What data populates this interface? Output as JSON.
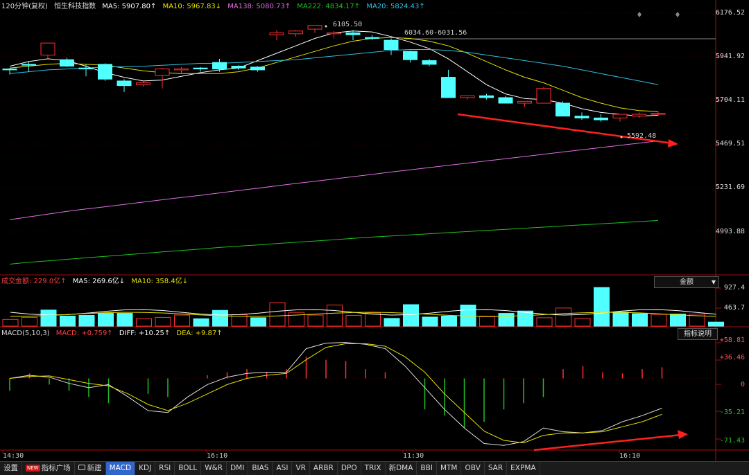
{
  "header": {
    "title": "120分钟(复权)",
    "instrument": "恒生科技指数",
    "ma5": "MA5: 5907.80↑",
    "ma10": "MA10: 5967.83↓",
    "ma138": "MA138: 5080.73↑",
    "ma222": "MA222: 4834.17↑",
    "ma20": "MA20: 5824.43↑"
  },
  "colors": {
    "ma5": "#ffffff",
    "ma10": "#e8e000",
    "ma138": "#e070e0",
    "ma222": "#20c020",
    "ma20": "#30c0e0",
    "up": "#ff3030",
    "down": "#50ffff",
    "annotation_arrow": "#ff2020"
  },
  "price_axis": [
    "6176.52",
    "5941.92",
    "5704.11",
    "5469.51",
    "5231.69",
    "4993.88"
  ],
  "annotations": {
    "high": "6105.50",
    "range": "6034.60-6031.56",
    "low": "5592.48"
  },
  "volume": {
    "label": "成交金额: 229.0亿↑",
    "ma5": "MA5: 269.6亿↓",
    "ma10": "MA10: 358.4亿↓",
    "axis": [
      "927.4",
      "463.7"
    ],
    "dropdown": "金额"
  },
  "macd": {
    "label": "MACD(5,10,3)",
    "macd": "MACD: +0.759↑",
    "diff": "DIFF: +10.25↑",
    "dea": "DEA: +9.87↑",
    "axis": [
      "+58.81",
      "+36.46",
      "0",
      "-35.21",
      "-71.43"
    ],
    "button": "指标说明"
  },
  "time_axis": [
    "14:30",
    "16:10",
    "11:30",
    "16:10"
  ],
  "toolbar": {
    "settings": "设置",
    "new_badge": "NEW",
    "indicator_plaza": "指标广场",
    "new_create": "新建",
    "tabs": [
      "MACD",
      "KDJ",
      "RSI",
      "BOLL",
      "W&R",
      "DMI",
      "BIAS",
      "ASI",
      "VR",
      "ARBR",
      "DPO",
      "TRIX",
      "新DMA",
      "BBI",
      "MTM",
      "OBV",
      "SAR",
      "EXPMA"
    ],
    "active_tab": "MACD"
  },
  "chart_data": {
    "type": "candlestick",
    "categories": 35,
    "ylim": [
      4800,
      6240
    ],
    "candles": [
      [
        5875,
        5880,
        5845,
        5870
      ],
      [
        5900,
        5915,
        5860,
        5895
      ],
      [
        5950,
        6010,
        5930,
        6015
      ],
      [
        5925,
        5935,
        5885,
        5890
      ],
      [
        5880,
        5900,
        5835,
        5875
      ],
      [
        5900,
        5905,
        5810,
        5820
      ],
      [
        5810,
        5820,
        5750,
        5785
      ],
      [
        5790,
        5810,
        5780,
        5800
      ],
      [
        5840,
        5880,
        5770,
        5875
      ],
      [
        5870,
        5885,
        5850,
        5875
      ],
      [
        5880,
        5885,
        5860,
        5875
      ],
      [
        5910,
        5930,
        5860,
        5875
      ],
      [
        5890,
        5895,
        5870,
        5880
      ],
      [
        5885,
        5890,
        5860,
        5870
      ],
      [
        6060,
        6085,
        6030,
        6070
      ],
      [
        6065,
        6085,
        6050,
        6080
      ],
      [
        6090,
        6110,
        6070,
        6110
      ],
      [
        6065,
        6080,
        6040,
        6070
      ],
      [
        6070,
        6085,
        6030,
        6060
      ],
      [
        6045,
        6060,
        6030,
        6040
      ],
      [
        6030,
        6040,
        5950,
        5980
      ],
      [
        5970,
        5975,
        5910,
        5925
      ],
      [
        5920,
        5930,
        5890,
        5900
      ],
      [
        5830,
        5870,
        5720,
        5720
      ],
      [
        5720,
        5730,
        5710,
        5730
      ],
      [
        5730,
        5740,
        5710,
        5720
      ],
      [
        5720,
        5730,
        5690,
        5690
      ],
      [
        5690,
        5700,
        5670,
        5700
      ],
      [
        5690,
        5780,
        5690,
        5770
      ],
      [
        5690,
        5700,
        5620,
        5620
      ],
      [
        5620,
        5640,
        5600,
        5610
      ],
      [
        5610,
        5630,
        5590,
        5600
      ],
      [
        5610,
        5620,
        5590,
        5630
      ],
      [
        5620,
        5640,
        5610,
        5630
      ],
      [
        5630,
        5645,
        5620,
        5635
      ]
    ],
    "ma_series": [
      {
        "name": "MA5",
        "values": [
          5890,
          5915,
          5930,
          5920,
          5890,
          5855,
          5830,
          5810,
          5815,
          5835,
          5855,
          5870,
          5880,
          5920,
          5960,
          6000,
          6040,
          6070,
          6080,
          6075,
          6050,
          6020,
          5985,
          5930,
          5860,
          5790,
          5740,
          5715,
          5710,
          5690,
          5660,
          5640,
          5630,
          5620,
          5625
        ]
      },
      {
        "name": "MA10",
        "values": [
          5880,
          5890,
          5900,
          5905,
          5900,
          5895,
          5880,
          5865,
          5855,
          5850,
          5850,
          5850,
          5860,
          5880,
          5910,
          5940,
          5970,
          6000,
          6025,
          6040,
          6045,
          6040,
          6025,
          6000,
          5960,
          5915,
          5870,
          5830,
          5800,
          5760,
          5720,
          5690,
          5665,
          5650,
          5645
        ]
      },
      {
        "name": "MA20",
        "values": [
          5850,
          5860,
          5870,
          5875,
          5880,
          5885,
          5888,
          5890,
          5895,
          5900,
          5905,
          5905,
          5910,
          5915,
          5920,
          5925,
          5935,
          5945,
          5955,
          5965,
          5975,
          5980,
          5980,
          5975,
          5965,
          5950,
          5935,
          5920,
          5905,
          5890,
          5870,
          5850,
          5830,
          5810,
          5790
        ]
      },
      {
        "name": "MA138",
        "values": [
          5060,
          5075,
          5090,
          5105,
          5118,
          5130,
          5143,
          5155,
          5168,
          5180,
          5192,
          5205,
          5218,
          5230,
          5243,
          5256,
          5268,
          5280,
          5293,
          5305,
          5318,
          5330,
          5342,
          5354,
          5366,
          5378,
          5390,
          5402,
          5414,
          5426,
          5438,
          5450,
          5462,
          5474,
          5486
        ]
      },
      {
        "name": "MA222",
        "values": [
          4820,
          4830,
          4838,
          4846,
          4854,
          4862,
          4870,
          4878,
          4886,
          4894,
          4902,
          4910,
          4917,
          4924,
          4931,
          4938,
          4945,
          4952,
          4959,
          4966,
          4972,
          4978,
          4984,
          4990,
          4996,
          5002,
          5008,
          5014,
          5020,
          5026,
          5032,
          5038,
          5044,
          5050,
          5056
        ]
      }
    ],
    "volume_values": [
      200,
      260,
      480,
      300,
      320,
      380,
      380,
      220,
      260,
      330,
      220,
      470,
      340,
      250,
      700,
      410,
      330,
      630,
      320,
      390,
      230,
      640,
      270,
      300,
      630,
      280,
      380,
      450,
      250,
      540,
      230,
      1150,
      420,
      370,
      350,
      360,
      360,
      120
    ],
    "volume_up": [
      true,
      true,
      false,
      false,
      false,
      false,
      false,
      true,
      true,
      true,
      false,
      false,
      true,
      false,
      true,
      true,
      true,
      true,
      true,
      true,
      false,
      false,
      false,
      false,
      false,
      true,
      false,
      false,
      true,
      true,
      true,
      false,
      false,
      false,
      true,
      false,
      true,
      false
    ],
    "volume_ylim": [
      0,
      1300
    ],
    "macd_diff": [
      0,
      5,
      2,
      -8,
      -15,
      -10,
      -30,
      -52,
      -55,
      -30,
      -10,
      2,
      8,
      10,
      10,
      48,
      57,
      58,
      55,
      48,
      20,
      -15,
      -50,
      -80,
      -105,
      -108,
      -102,
      -80,
      -86,
      -88,
      -84,
      -70,
      -60,
      -48
    ],
    "macd_dea": [
      0,
      3,
      4,
      -2,
      -8,
      -12,
      -25,
      -42,
      -52,
      -40,
      -25,
      -10,
      0,
      5,
      8,
      30,
      50,
      56,
      56,
      52,
      35,
      10,
      -25,
      -55,
      -85,
      -100,
      -104,
      -92,
      -88,
      -88,
      -86,
      -78,
      -70,
      -58
    ],
    "macd_bars": [
      -20,
      8,
      -10,
      -20,
      -30,
      -40,
      0,
      -25,
      -30,
      0,
      5,
      10,
      15,
      10,
      15,
      35,
      30,
      28,
      15,
      10,
      0,
      -50,
      -60,
      -80,
      -70,
      -50,
      -40,
      -30,
      15,
      20,
      10,
      8,
      15,
      18
    ],
    "macd_ylim": [
      -100,
      62
    ],
    "time_labels": [
      "14:30",
      "16:10",
      "11:30",
      "16:10"
    ]
  }
}
